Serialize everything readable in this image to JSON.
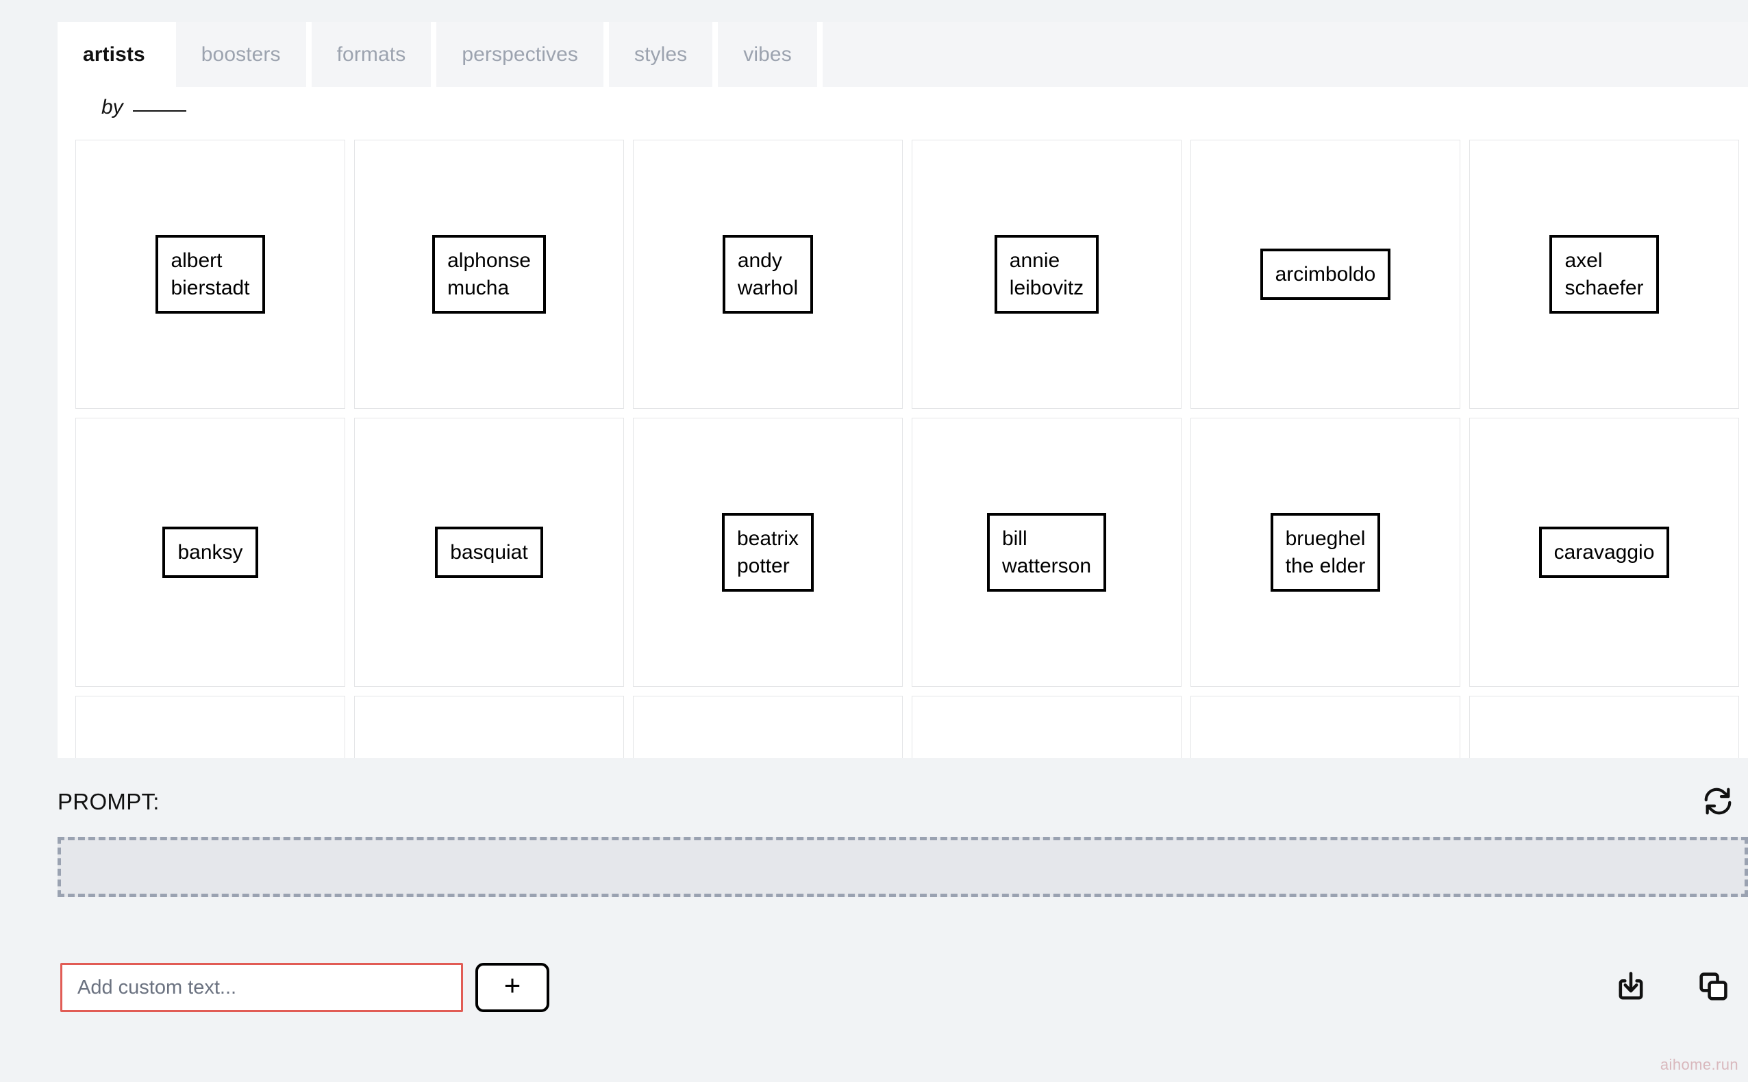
{
  "tabs": [
    {
      "label": "artists",
      "active": true
    },
    {
      "label": "boosters",
      "active": false
    },
    {
      "label": "formats",
      "active": false
    },
    {
      "label": "perspectives",
      "active": false
    },
    {
      "label": "styles",
      "active": false
    },
    {
      "label": "vibes",
      "active": false
    }
  ],
  "subtitle": {
    "by_word": "by",
    "blank": "________"
  },
  "grid": {
    "columns": 6,
    "cards": [
      {
        "line1": "albert",
        "line2": "bierstadt"
      },
      {
        "line1": "alphonse",
        "line2": "mucha"
      },
      {
        "line1": "andy",
        "line2": "warhol"
      },
      {
        "line1": "annie",
        "line2": "leibovitz"
      },
      {
        "line1": "arcimboldo",
        "line2": ""
      },
      {
        "line1": "axel",
        "line2": "schaefer"
      },
      {
        "line1": "banksy",
        "line2": ""
      },
      {
        "line1": "basquiat",
        "line2": ""
      },
      {
        "line1": "beatrix",
        "line2": "potter"
      },
      {
        "line1": "bill",
        "line2": "watterson"
      },
      {
        "line1": "brueghel",
        "line2": "the elder"
      },
      {
        "line1": "caravaggio",
        "line2": ""
      },
      {
        "line1": "",
        "line2": ""
      },
      {
        "line1": "",
        "line2": ""
      },
      {
        "line1": "",
        "line2": ""
      },
      {
        "line1": "",
        "line2": ""
      },
      {
        "line1": "",
        "line2": ""
      },
      {
        "line1": "",
        "line2": ""
      }
    ]
  },
  "prompt": {
    "label": "PROMPT:",
    "value": "",
    "refresh_icon": "refresh-icon"
  },
  "bottom": {
    "custom_input_value": "",
    "custom_input_placeholder": "Add custom text...",
    "add_label": "+",
    "download_icon": "download-icon",
    "copy_icon": "copy-icon"
  },
  "watermark": "aihome.run",
  "colors": {
    "page_bg": "#f1f3f5",
    "panel_bg": "#ffffff",
    "tab_inactive_bg": "#f4f5f7",
    "tab_inactive_text": "#9ca3af",
    "tab_active_text": "#111111",
    "card_border": "#e4e5e7",
    "chip_border": "#000000",
    "dropzone_bg": "#e5e7eb",
    "dropzone_border": "#9aa2b1",
    "input_border": "#e15c55",
    "watermark": "#d9b8bd"
  }
}
